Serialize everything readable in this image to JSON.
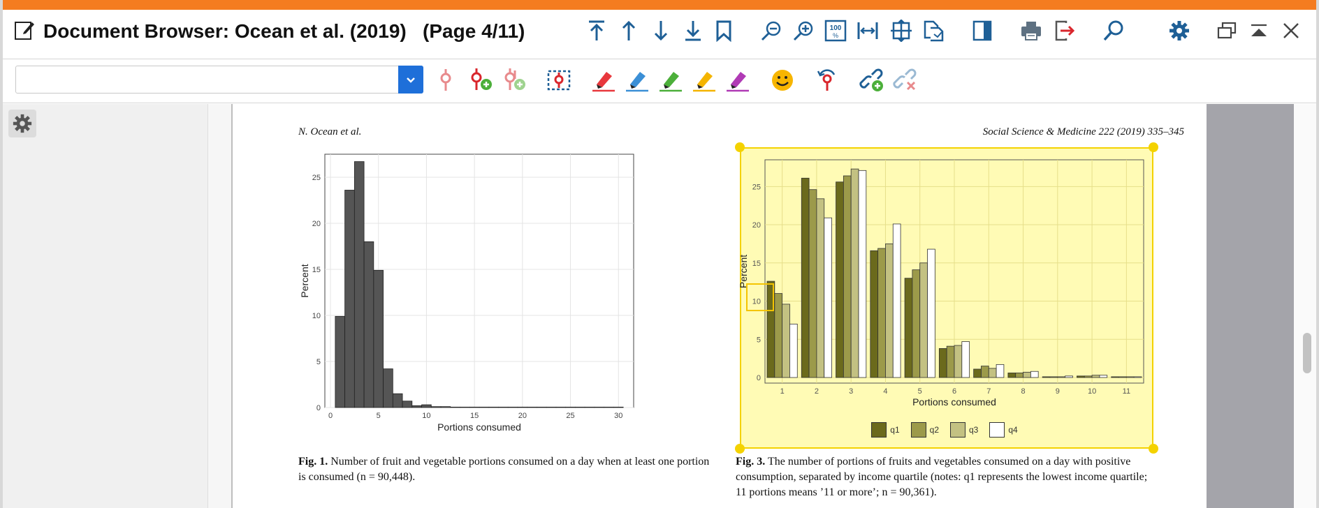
{
  "window": {
    "title": "Document Browser: Ocean et al. (2019)   (Page 4/11)",
    "accent_color": "#f47c20",
    "toolbar_icon_color": "#1e5f96"
  },
  "toolbar": {
    "icons": [
      "jump-to-top-icon",
      "arrow-up-icon",
      "arrow-down-icon",
      "jump-to-bottom-icon",
      "bookmark-icon",
      "zoom-out-icon",
      "zoom-in-icon",
      "zoom-100-icon",
      "fit-width-icon",
      "fit-page-icon",
      "export-pages-icon",
      "toggle-panel-icon",
      "print-icon",
      "exit-icon",
      "search-icon",
      "settings-icon",
      "restore-window-icon",
      "minimize-window-icon",
      "close-icon"
    ]
  },
  "annotation_toolbar": {
    "search": {
      "value": "",
      "placeholder": ""
    },
    "icons": [
      "code-pin-icon",
      "add-code-icon",
      "add-code-disabled-icon",
      "area-code-icon",
      "red-marker-icon",
      "blue-marker-icon",
      "green-marker-icon",
      "yellow-marker-icon",
      "purple-marker-icon",
      "emoticon-icon",
      "undo-code-icon",
      "add-link-icon",
      "remove-link-icon"
    ],
    "marker_colors": [
      "#e8383d",
      "#3b8fd6",
      "#4caf3a",
      "#f4b400",
      "#b03ab5"
    ]
  },
  "document": {
    "running_head_left": "N. Ocean et al.",
    "running_head_right": "Social Science & Medicine 222 (2019) 335–345",
    "fig1": {
      "caption_label": "Fig. 1.",
      "caption_text": "Number of fruit and vegetable portions consumed on a day when at least one portion is consumed (n = 90,448).",
      "chart_data": {
        "type": "bar",
        "xlabel": "Portions consumed",
        "ylabel": "Percent",
        "xlim": [
          0,
          31
        ],
        "ylim": [
          0,
          27.5
        ],
        "xticks": [
          0,
          5,
          10,
          15,
          20,
          25,
          30
        ],
        "yticks": [
          0,
          5,
          10,
          15,
          20,
          25
        ],
        "x": [
          1,
          2,
          3,
          4,
          5,
          6,
          7,
          8,
          9,
          10,
          11,
          12,
          13,
          14,
          15,
          16,
          17,
          18,
          19,
          20,
          21,
          22,
          23,
          24,
          25,
          26,
          27,
          28,
          29,
          30
        ],
        "values": [
          9.9,
          23.6,
          26.7,
          18.0,
          14.9,
          4.2,
          1.5,
          0.7,
          0.2,
          0.3,
          0.1,
          0.1,
          0.05,
          0.05,
          0.05,
          0.05,
          0.05,
          0.05,
          0.05,
          0.05,
          0.05,
          0.05,
          0.05,
          0.05,
          0.05,
          0.05,
          0.05,
          0.05,
          0.05,
          0.05
        ],
        "bar_color": "#555555",
        "grid": true
      }
    },
    "fig3": {
      "caption_label": "Fig. 3.",
      "caption_text": "The number of portions of fruits and vegetables consumed on a day with positive consumption, separated by income quartile (notes: q1 represents the lowest income quartile; 11 portions means ’11 or more’; n = 90,361).",
      "chart_data": {
        "type": "bar",
        "xlabel": "Portions consumed",
        "ylabel": "Percent",
        "ylim": [
          0,
          28.5
        ],
        "yticks": [
          0,
          5,
          10,
          15,
          20,
          25
        ],
        "categories": [
          "1",
          "2",
          "3",
          "4",
          "5",
          "6",
          "7",
          "8",
          "9",
          "10",
          "11"
        ],
        "series": [
          {
            "name": "q1",
            "color": "#6b6a1c",
            "values": [
              12.6,
              26.1,
              25.6,
              16.6,
              13.0,
              3.8,
              1.1,
              0.6,
              0.1,
              0.2,
              0.1
            ]
          },
          {
            "name": "q2",
            "color": "#9c9a4a",
            "values": [
              11.0,
              24.6,
              26.4,
              16.9,
              14.1,
              4.1,
              1.5,
              0.6,
              0.1,
              0.2,
              0.1
            ]
          },
          {
            "name": "q3",
            "color": "#c3c182",
            "values": [
              9.6,
              23.4,
              27.3,
              17.5,
              15.0,
              4.2,
              1.2,
              0.7,
              0.1,
              0.3,
              0.1
            ]
          },
          {
            "name": "q4",
            "color": "#ffffff",
            "values": [
              7.0,
              20.9,
              27.1,
              20.1,
              16.8,
              4.7,
              1.7,
              0.8,
              0.2,
              0.3,
              0.1
            ]
          }
        ],
        "legend": "bottom",
        "grid": true
      }
    }
  }
}
